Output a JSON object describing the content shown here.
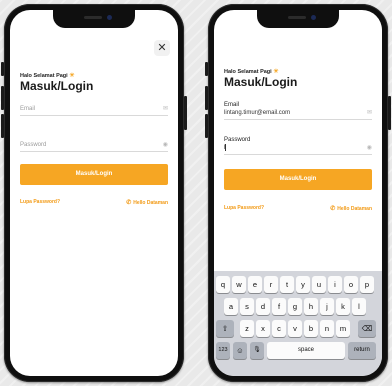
{
  "login": {
    "greeting": "Halo Selamat Pagi",
    "sun_icon": "sun-icon",
    "title": "Masuk/Login",
    "email_label": "Email",
    "email_placeholder": "Email",
    "email_value": "lintang.timur@email.com",
    "password_label": "Password",
    "password_placeholder": "Password",
    "password_value": "l",
    "button_label": "Masuk/Login",
    "forgot_label": "Lupa Password?",
    "help_label": "Hello Dataman",
    "close_glyph": "✕"
  },
  "keyboard": {
    "row1": [
      "q",
      "w",
      "e",
      "r",
      "t",
      "y",
      "u",
      "i",
      "o",
      "p"
    ],
    "row2": [
      "a",
      "s",
      "d",
      "f",
      "g",
      "h",
      "j",
      "k",
      "l"
    ],
    "row3": [
      "z",
      "x",
      "c",
      "v",
      "b",
      "n",
      "m"
    ],
    "shift_glyph": "⇧",
    "delete_glyph": "⌫",
    "numbers_label": "123",
    "emoji_glyph": "☺",
    "mic_glyph": "🎙",
    "space_label": "space",
    "return_label": "return"
  },
  "colors": {
    "accent": "#F6A623",
    "link": "#F29A15"
  }
}
